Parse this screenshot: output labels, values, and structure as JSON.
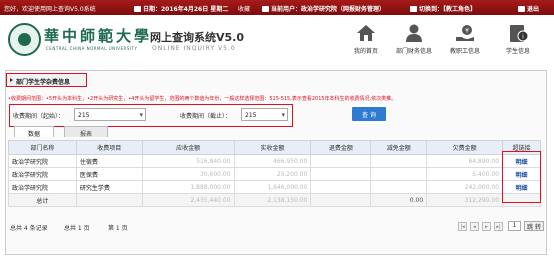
{
  "topbar": {
    "welcome": "您好，欢迎使用网上查询V5.0系统",
    "date": "日期：2016年4月26日 星期二",
    "favorite": "收藏",
    "current_user": "当前用户：政治学研究院（网报财务管理）",
    "switch_role": "切换到：【教工角色】",
    "logout": "退出"
  },
  "header": {
    "logo_cn": "華中師範大學",
    "logo_en": "CENTRAL CHINA NORMAL UNIVERSITY",
    "system_title": "网上查询系统V5.0",
    "system_subtitle": "ONLINE INQUIRY V5.0",
    "nav": [
      {
        "label": "我的首页",
        "icon": "home-icon"
      },
      {
        "label": "部门财务信息",
        "icon": "user-icon"
      },
      {
        "label": "教职工信息",
        "icon": "money-hand-icon"
      },
      {
        "label": "学生信息",
        "icon": "student-info-icon"
      }
    ]
  },
  "breadcrumb": "部门学生学杂费信息",
  "notice": "•收费期间范围：•5开头为本科生，•2开头为研究生，•4开头为留学生，范围的两个数值为年份，一般这样选择范围：515-515,表示查看2015年本科生的收费情况,依次类推。",
  "filter": {
    "start_label": "收费期间（起始）：",
    "start_value": "215",
    "end_label": "收费期间（截止）：",
    "end_value": "215",
    "query_button": "查 询"
  },
  "tabs": [
    {
      "label": "数据",
      "active": true
    },
    {
      "label": "报表",
      "active": false
    }
  ],
  "table": {
    "headers": [
      "部门名称",
      "收费项目",
      "应收金额",
      "实收金额",
      "退费金额",
      "减免金额",
      "欠费金额",
      "超链接"
    ],
    "rows": [
      {
        "dept": "政治学研究院",
        "item": "住宿费",
        "due": "516,840.00",
        "received": "466,950.00",
        "refund": "",
        "waiver": "",
        "owed": "64,890.00",
        "link": "明细"
      },
      {
        "dept": "政治学研究院",
        "item": "医保费",
        "due": "30,600.00",
        "received": "25,200.00",
        "refund": "",
        "waiver": "",
        "owed": "5,400.00",
        "link": "明细"
      },
      {
        "dept": "政治学研究院",
        "item": "研究生学费",
        "due": "1,888,000.00",
        "received": "1,646,000.00",
        "refund": "",
        "waiver": "",
        "owed": "242,000.00",
        "link": "明细"
      }
    ],
    "total": {
      "label": "总计",
      "due": "2,435,440.00",
      "received": "2,138,150.00",
      "refund": "",
      "waiver": "0.00",
      "owed": "312,290.00"
    }
  },
  "pager": {
    "summary": "总共 4 条记录",
    "total_pages": "总共 1 页",
    "current": "第 1 页",
    "page_input": "1",
    "go_button": "跳 转"
  },
  "colors": {
    "accent_red": "#d12222",
    "topbar": "#8c1010",
    "query_button": "#2f7bd0",
    "link": "#1a4fa0",
    "brand_green": "#1f6b4f"
  }
}
